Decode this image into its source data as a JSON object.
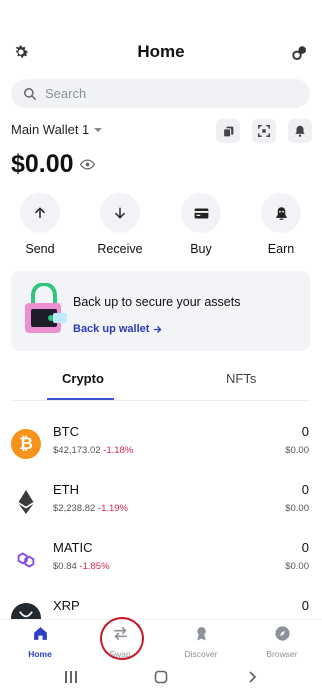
{
  "header": {
    "title": "Home"
  },
  "search": {
    "placeholder": "Search"
  },
  "wallet": {
    "name": "Main Wallet 1",
    "balance": "$0.00"
  },
  "actions": [
    {
      "label": "Send",
      "icon": "arrow-up-icon"
    },
    {
      "label": "Receive",
      "icon": "arrow-down-icon"
    },
    {
      "label": "Buy",
      "icon": "card-icon"
    },
    {
      "label": "Earn",
      "icon": "earn-icon"
    }
  ],
  "backup": {
    "title": "Back up to secure your assets",
    "link": "Back up wallet"
  },
  "tabs": [
    {
      "label": "Crypto",
      "active": true
    },
    {
      "label": "NFTs",
      "active": false
    }
  ],
  "tokens": [
    {
      "symbol": "BTC",
      "price": "$42,173.02",
      "change": "-1.18%",
      "amount": "0",
      "fiat": "$0.00",
      "color": "#f7931a"
    },
    {
      "symbol": "ETH",
      "price": "$2,238.82",
      "change": "-1.19%",
      "amount": "0",
      "fiat": "$0.00",
      "color": "#3c3c3d"
    },
    {
      "symbol": "MATIC",
      "price": "$0.84",
      "change": "-1.85%",
      "amount": "0",
      "fiat": "$0.00",
      "color": "#8247e5"
    },
    {
      "symbol": "XRP",
      "price": "",
      "change": "",
      "amount": "0",
      "fiat": "",
      "color": "#23292f"
    }
  ],
  "nav": [
    {
      "label": "Home",
      "active": true
    },
    {
      "label": "Swap",
      "active": false
    },
    {
      "label": "Discover",
      "active": false
    },
    {
      "label": "Browser",
      "active": false
    }
  ],
  "colors": {
    "accent": "#3c52d8",
    "negative": "#d12b4a",
    "highlight": "#c8182a"
  }
}
